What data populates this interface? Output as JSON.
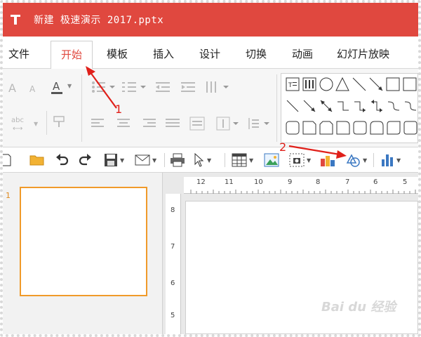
{
  "window": {
    "title": "新建 极速演示 2017.pptx",
    "app_logo_icon": "presentation-logo-icon",
    "title_bar_color": "#e0483f"
  },
  "menu": {
    "tabs": [
      {
        "label": "文件"
      },
      {
        "label": "开始",
        "active": true
      },
      {
        "label": "模板"
      },
      {
        "label": "插入"
      },
      {
        "label": "设计"
      },
      {
        "label": "切换"
      },
      {
        "label": "动画"
      },
      {
        "label": "幻灯片放映"
      }
    ],
    "active_color": "#e0483f"
  },
  "ribbon": {
    "font_sample": "abc",
    "shape_icons": [
      "text-box-icon",
      "vertical-text-box-icon",
      "oval-icon",
      "triangle-icon",
      "line-icon",
      "arrow-line-icon",
      "rectangle-icon",
      "diagonal-line-icon",
      "diagonal-arrow-icon",
      "double-arrow-icon",
      "elbow-connector-icon",
      "elbow-arrow-connector-icon",
      "elbow-double-arrow-icon",
      "curved-connector-icon",
      "rounded-rect-icon",
      "snip-rect-icon",
      "snip-round-rect-icon",
      "round-single-corner-icon",
      "plaque-icon",
      "round-same-side-icon",
      "round-diagonal-icon"
    ]
  },
  "toolbar": {
    "items": [
      "new-icon",
      "open-folder-icon",
      "undo-icon",
      "redo-icon",
      "save-icon",
      "email-icon",
      "print-icon",
      "select-pointer-icon",
      "table-icon",
      "picture-icon",
      "screenshot-icon",
      "chart-insert-icon",
      "shapes-icon",
      "bar-chart-icon"
    ]
  },
  "thumbnails": {
    "slide_number": "1",
    "border_color": "#f09a2a"
  },
  "ruler": {
    "horizontal": [
      "12",
      "11",
      "10",
      "9",
      "8",
      "7",
      "6",
      "5"
    ],
    "vertical": [
      "8",
      "7",
      "6",
      "5"
    ]
  },
  "annotations": {
    "label_1": "1",
    "label_2": "2",
    "color": "#e0201a"
  },
  "watermark": {
    "text": "Bai du 经验"
  }
}
